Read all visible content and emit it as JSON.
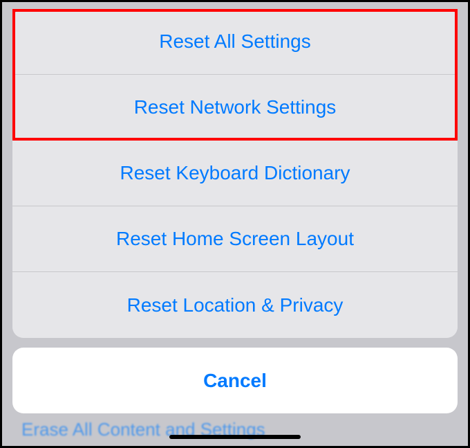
{
  "options": [
    {
      "label": "Reset All Settings",
      "name": "reset-all-settings-option"
    },
    {
      "label": "Reset Network Settings",
      "name": "reset-network-settings-option"
    },
    {
      "label": "Reset Keyboard Dictionary",
      "name": "reset-keyboard-dictionary-option"
    },
    {
      "label": "Reset Home Screen Layout",
      "name": "reset-home-screen-layout-option"
    },
    {
      "label": "Reset Location & Privacy",
      "name": "reset-location-privacy-option"
    }
  ],
  "cancel": {
    "label": "Cancel"
  },
  "obscured_text": "Erase All Content and Settings",
  "highlight_indices": [
    0,
    1
  ]
}
